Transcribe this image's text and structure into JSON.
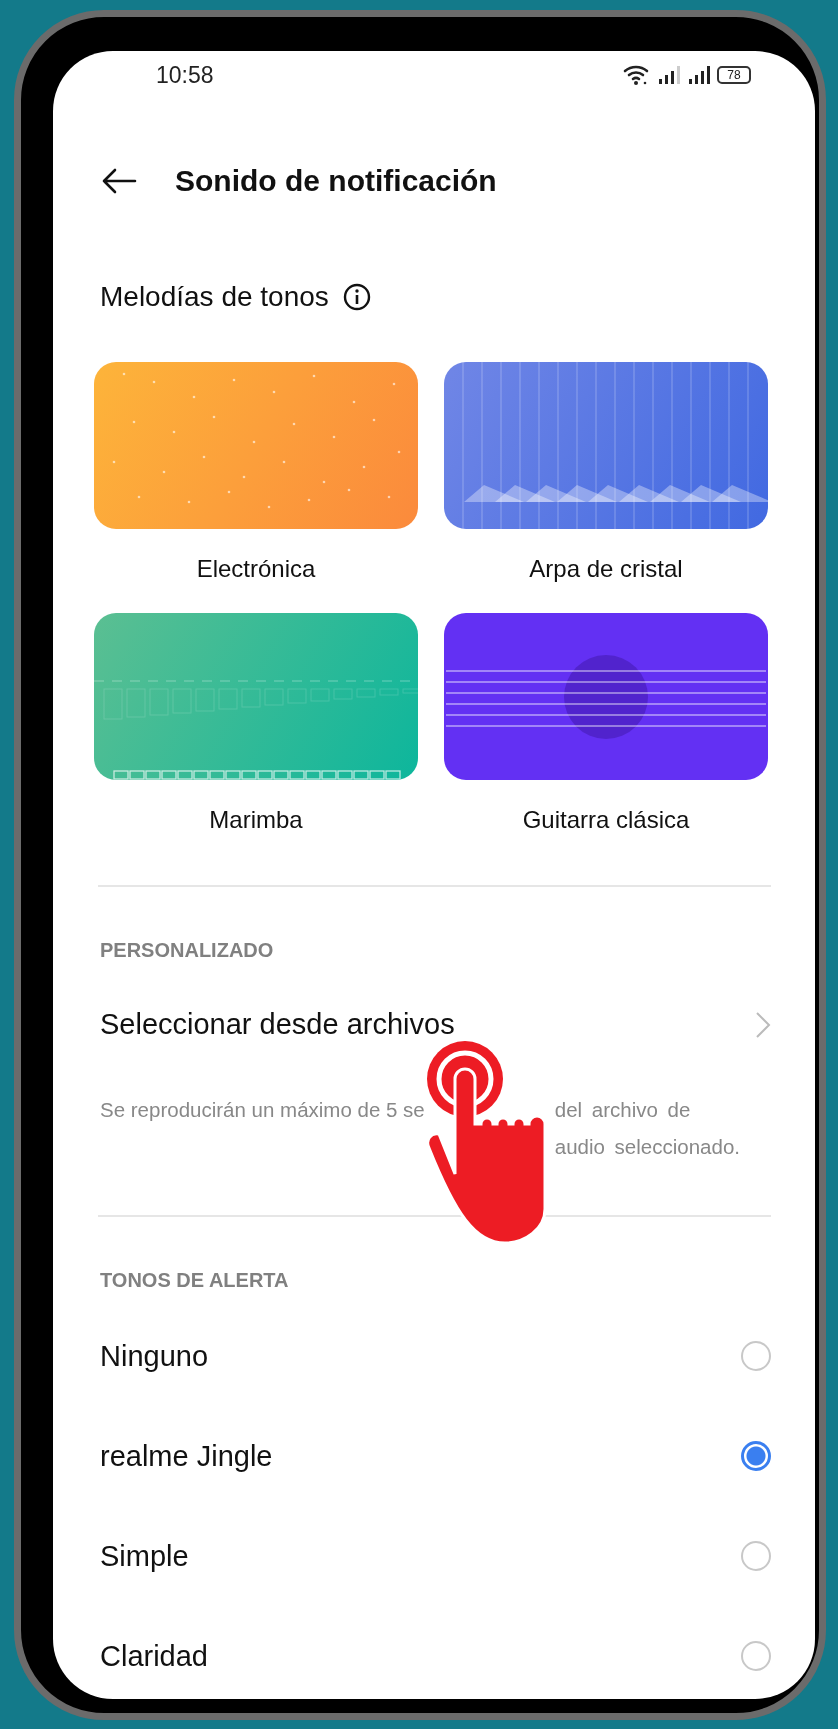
{
  "status_bar": {
    "time": "10:58",
    "battery": "78"
  },
  "header": {
    "title": "Sonido de notificación"
  },
  "ringtones": {
    "title": "Melodías de tonos",
    "items": [
      {
        "label": "Electrónica",
        "kind": "dots"
      },
      {
        "label": "Arpa de cristal",
        "kind": "harp"
      },
      {
        "label": "Marimba",
        "kind": "marimba"
      },
      {
        "label": "Guitarra clásica",
        "kind": "guitar"
      }
    ]
  },
  "custom": {
    "heading": "PERSONALIZADO",
    "action": "Seleccionar desde archivos",
    "note_parts": [
      "Se reproducirán un máximo de 5 se",
      "del archivo de audio seleccionado."
    ]
  },
  "alerts": {
    "heading": "TONOS DE ALERTA",
    "items": [
      {
        "label": "Ninguno",
        "selected": false
      },
      {
        "label": "realme Jingle",
        "selected": true
      },
      {
        "label": "Simple",
        "selected": false
      },
      {
        "label": "Claridad",
        "selected": false
      }
    ]
  }
}
